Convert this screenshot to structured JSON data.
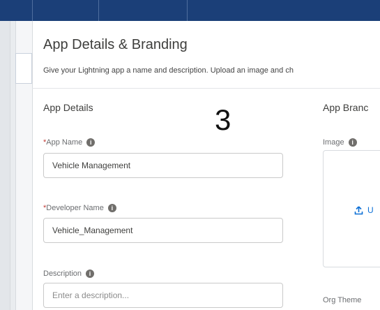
{
  "page": {
    "title": "App Details & Branding",
    "subtitle": "Give your Lightning app a name and description. Upload an image and ch",
    "overlay_number": "3"
  },
  "sections": {
    "app_details": "App Details",
    "app_branding": "App Branc"
  },
  "fields": {
    "app_name": {
      "label": "App Name",
      "required_mark": "*",
      "value": "Vehicle Management"
    },
    "developer_name": {
      "label": "Developer Name",
      "required_mark": "*",
      "value": "Vehicle_Management"
    },
    "description": {
      "label": "Description",
      "placeholder": "Enter a description..."
    }
  },
  "branding": {
    "image_label": "Image",
    "upload_label": "U",
    "org_theme_label": "Org Theme"
  },
  "icons": {
    "info": "info-icon",
    "upload": "upload-icon"
  },
  "colors": {
    "header": "#1b3f78",
    "required": "#c23934",
    "link": "#0b6fd6"
  }
}
